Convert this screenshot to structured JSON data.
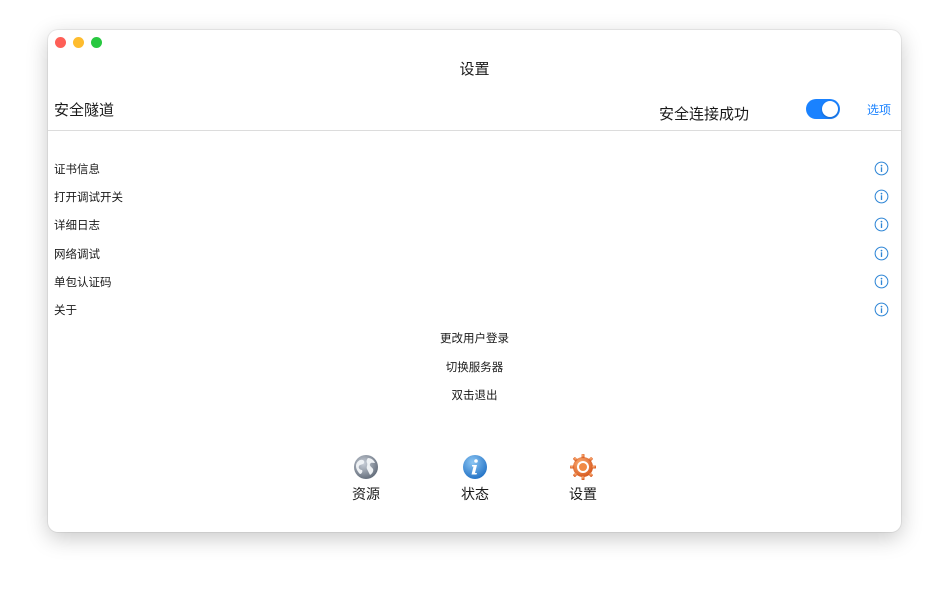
{
  "window": {
    "title": "设置"
  },
  "tunnel": {
    "label": "安全隧道",
    "status": "安全连接成功",
    "toggle_on": true,
    "options_label": "选项"
  },
  "menu": {
    "items": [
      {
        "label": "证书信息"
      },
      {
        "label": "打开调试开关"
      },
      {
        "label": "详细日志"
      },
      {
        "label": "网络调试"
      },
      {
        "label": "单包认证码"
      },
      {
        "label": "关于"
      }
    ]
  },
  "actions": {
    "switch_user": "更改用户登录",
    "switch_server": "切换服务器",
    "exit": "双击退出"
  },
  "tabs": [
    {
      "label": "资源",
      "icon": "globe-icon"
    },
    {
      "label": "状态",
      "icon": "info-icon"
    },
    {
      "label": "设置",
      "icon": "gear-icon"
    }
  ],
  "colors": {
    "accent": "#1a82ff",
    "status_icon": "#2f86d6",
    "gear": "#e56a25"
  }
}
